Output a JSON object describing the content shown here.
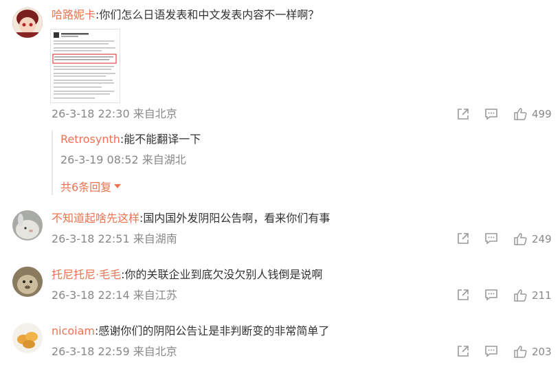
{
  "comments": [
    {
      "user": "哈路妮卡",
      "sep": ":",
      "text": "你们怎么日语发表和中文发表内容不一样啊？",
      "meta": "26-3-18 22:30 来自北京",
      "likes": "499",
      "has_image": true,
      "reply": {
        "user": "Retrosynth",
        "sep": ":",
        "text": "能不能翻译一下",
        "meta": "26-3-19 08:52 来自湖北"
      },
      "more_replies": "共6条回复"
    },
    {
      "user": "不知道起啥先这样",
      "sep": ":",
      "text": "国内国外发阴阳公告啊，看来你们有事",
      "meta": "26-3-18 22:51 来自湖南",
      "likes": "249"
    },
    {
      "user": "托尼托尼·毛毛",
      "sep": ":",
      "text": "你的关联企业到底欠没欠别人钱倒是说啊",
      "meta": "26-3-18 22:14 来自江苏",
      "likes": "211"
    },
    {
      "user": "nicoiam",
      "sep": ":",
      "text": "感谢你们的阴阳公告让是非判断变的非常简单了",
      "meta": "26-3-18 22:59 来自北京",
      "likes": "203"
    }
  ],
  "colors": {
    "username": "#eb7350",
    "meta": "#888888",
    "icon": "#9a9a9a"
  }
}
